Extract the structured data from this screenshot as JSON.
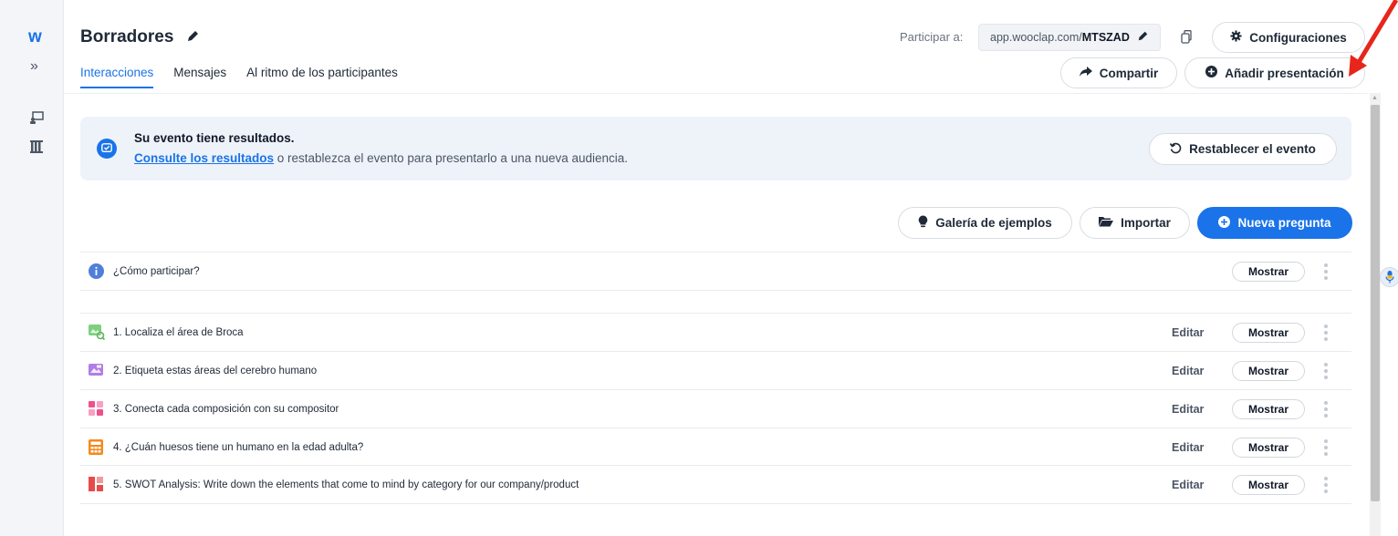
{
  "app": {
    "logo": "w",
    "title": "Borradores"
  },
  "tabs": [
    {
      "label": "Interacciones",
      "active": true
    },
    {
      "label": "Mensajes",
      "active": false
    },
    {
      "label": "Al ritmo de los participantes",
      "active": false
    }
  ],
  "header": {
    "participar_label": "Participar a:",
    "url_prefix": "app.wooclap.com/",
    "event_code": "MTSZAD",
    "config_label": "Configuraciones",
    "share_label": "Compartir",
    "add_presentation_label": "Añadir presentación"
  },
  "banner": {
    "title": "Su evento tiene resultados.",
    "link_text": "Consulte los resultados",
    "rest_text": " o restablezca el evento para presentarlo a una nueva audiencia.",
    "reset_label": "Restablecer el evento"
  },
  "actions": {
    "gallery_label": "Galería de ejemplos",
    "import_label": "Importar",
    "new_question_label": "Nueva pregunta"
  },
  "intro_row": {
    "label": "¿Cómo participar?",
    "show_label": "Mostrar"
  },
  "questions": [
    {
      "label": "1. Localiza el área de Broca",
      "icon": "find-on-image-icon",
      "color": "#7ed07e"
    },
    {
      "label": "2. Etiqueta estas áreas del cerebro humano",
      "icon": "label-image-icon",
      "color": "#b07de8"
    },
    {
      "label": "3. Conecta cada composición con su compositor",
      "icon": "matching-icon",
      "color": "#f0508a"
    },
    {
      "label": "4. ¿Cuán huesos tiene un humano en la edad adulta?",
      "icon": "numerical-icon",
      "color": "#f28a1e"
    },
    {
      "label": "5. SWOT Analysis: Write down the elements that come to mind by category for our company/product",
      "icon": "swot-icon",
      "color": "#e84a4a"
    }
  ],
  "row_actions": {
    "edit_label": "Editar",
    "show_label": "Mostrar"
  },
  "colors": {
    "accent": "#1a73e8",
    "annotation_arrow": "#e8251b"
  }
}
